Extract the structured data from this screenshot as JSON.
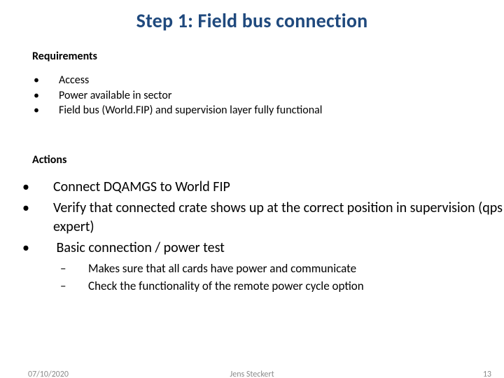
{
  "title": "Step 1: Field bus connection",
  "requirements": {
    "heading": "Requirements",
    "items": [
      "Access",
      "Power available in sector",
      "Field bus (World.FIP) and supervision layer fully functional"
    ]
  },
  "actions": {
    "heading": "Actions",
    "items": [
      {
        "text": "Connect DQAMGS to World FIP"
      },
      {
        "text": "Verify that connected crate shows up at the correct position in supervision (qps expert)"
      },
      {
        "text": "Basic connection / power test",
        "sub": [
          "Makes sure that all cards have power and communicate",
          "Check the functionality of the remote power cycle option"
        ]
      }
    ]
  },
  "footer": {
    "date": "07/10/2020",
    "author": "Jens Steckert",
    "page": "13"
  }
}
